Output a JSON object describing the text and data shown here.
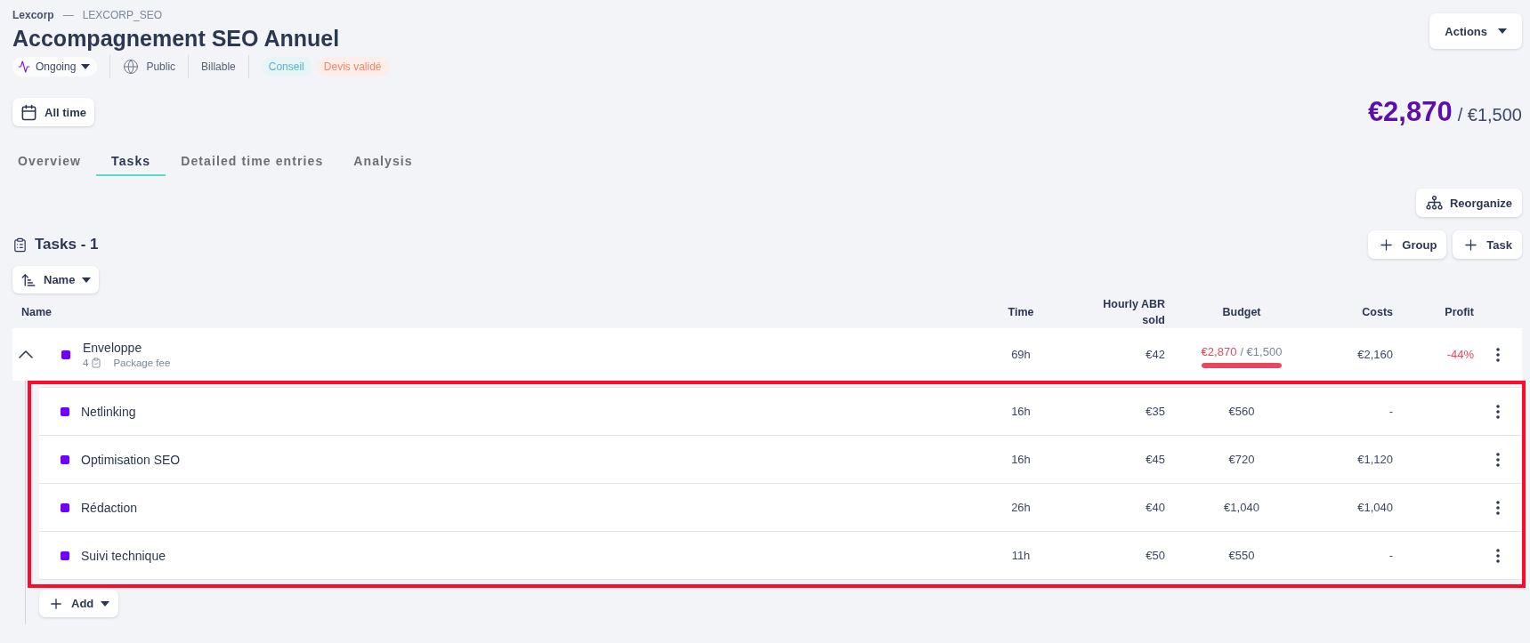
{
  "breadcrumb": {
    "client": "Lexcorp",
    "separator": "—",
    "project": "LEXCORP_SEO"
  },
  "title": "Accompagnement SEO Annuel",
  "meta": {
    "status": "Ongoing",
    "visibility": "Public",
    "billing": "Billable",
    "tags": [
      {
        "label": "Conseil",
        "color": "#55b6c9"
      },
      {
        "label": "Devis validé",
        "color": "#f4866a"
      }
    ]
  },
  "actions_button": "Actions",
  "period_button": "All time",
  "totals": {
    "spent": "€2,870",
    "budget": "/ €1,500"
  },
  "tabs": [
    {
      "label": "Overview",
      "selected": false
    },
    {
      "label": "Tasks",
      "selected": true
    },
    {
      "label": "Detailed time entries",
      "selected": false
    },
    {
      "label": "Analysis",
      "selected": false
    }
  ],
  "reorganize_button": "Reorganize",
  "tasks_heading": "Tasks - 1",
  "create_buttons": [
    "Group",
    "Task"
  ],
  "sort_button": "Name",
  "table": {
    "columns": [
      "Name",
      "Time",
      "Hourly ABR sold",
      "Budget",
      "Costs",
      "Profit"
    ],
    "groups": [
      {
        "name": "Enveloppe",
        "color": "#7000ff",
        "expanded": true,
        "highlighted": true,
        "task_count": "4",
        "billing": "Package fee",
        "time": "69h",
        "rate": "€42",
        "budget": {
          "spent": "€2,870",
          "total": "/ €1,500",
          "over": true,
          "level": 1
        },
        "costs": "€2,160",
        "profit": {
          "text": "-44%",
          "negative": true
        },
        "tasks": [
          {
            "name": "Netlinking",
            "color": "#7000ff",
            "time": "16h",
            "rate": "€35",
            "budget": "€560",
            "costs": "-"
          },
          {
            "name": "Optimisation SEO",
            "color": "#7000ff",
            "time": "16h",
            "rate": "€45",
            "budget": "€720",
            "costs": "€1,120"
          },
          {
            "name": "Rédaction",
            "color": "#7000ff",
            "time": "26h",
            "rate": "€40",
            "budget": "€1,040",
            "costs": "€1,040"
          },
          {
            "name": "Suivi technique",
            "color": "#7000ff",
            "time": "11h",
            "rate": "€50",
            "budget": "€550",
            "costs": "-"
          }
        ],
        "add_button": "Add"
      }
    ]
  }
}
